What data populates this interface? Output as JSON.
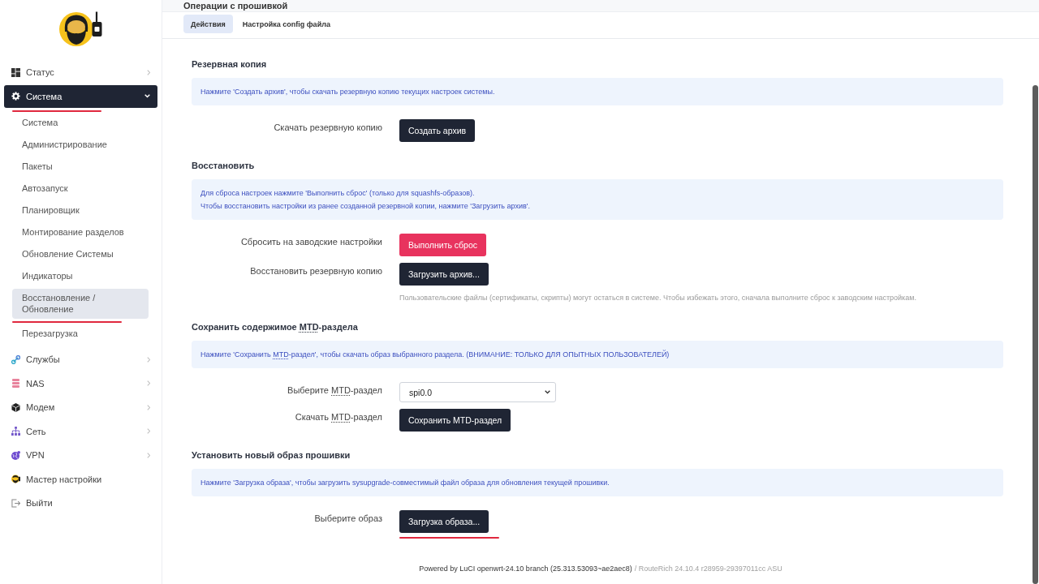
{
  "page_title": "Операции с прошивкой",
  "sidebar": {
    "items": [
      {
        "label": "Статус",
        "kind": "group",
        "expanded": false,
        "selected": false,
        "marked": false
      },
      {
        "label": "Система",
        "kind": "group",
        "expanded": true,
        "selected": true,
        "marked": true,
        "children": [
          {
            "label": "Система",
            "selected": false,
            "marked": false
          },
          {
            "label": "Администрирование",
            "selected": false,
            "marked": false
          },
          {
            "label": "Пакеты",
            "selected": false,
            "marked": false
          },
          {
            "label": "Автозапуск",
            "selected": false,
            "marked": false
          },
          {
            "label": "Планировщик",
            "selected": false,
            "marked": false
          },
          {
            "label": "Монтирование разделов",
            "selected": false,
            "marked": false
          },
          {
            "label": "Обновление Системы",
            "selected": false,
            "marked": false
          },
          {
            "label": "Индикаторы",
            "selected": false,
            "marked": false
          },
          {
            "label": "Восстановление / Обновление",
            "selected": true,
            "marked": true
          },
          {
            "label": "Перезагрузка",
            "selected": false,
            "marked": false
          }
        ]
      },
      {
        "label": "Службы",
        "kind": "group",
        "expanded": false,
        "selected": false,
        "marked": false
      },
      {
        "label": "NAS",
        "kind": "group",
        "expanded": false,
        "selected": false,
        "marked": false
      },
      {
        "label": "Модем",
        "kind": "group",
        "expanded": false,
        "selected": false,
        "marked": false
      },
      {
        "label": "Сеть",
        "kind": "group",
        "expanded": false,
        "selected": false,
        "marked": false
      },
      {
        "label": "VPN",
        "kind": "group",
        "expanded": false,
        "selected": false,
        "marked": false
      },
      {
        "label": "Мастер настройки",
        "kind": "link",
        "selected": false,
        "marked": false
      },
      {
        "label": "Выйти",
        "kind": "link",
        "selected": false,
        "marked": false
      }
    ]
  },
  "tabs": [
    {
      "label": "Действия",
      "selected": true
    },
    {
      "label": "Настройка config файла",
      "selected": false
    }
  ],
  "sections": [
    {
      "title": "Резервная копия",
      "info": [
        "Нажмите 'Создать архив', чтобы скачать резервную копию текущих настроек системы."
      ],
      "rows": [
        {
          "label": "Скачать резервную копию",
          "kind": "button",
          "button": "Создать архив",
          "destructive": false,
          "marked": false
        }
      ]
    },
    {
      "title": "Восстановить",
      "info": [
        "Для сброса настроек нажмите 'Выполнить сброс' (только для squashfs-образов).",
        "Чтобы восстановить настройки из ранее созданной резервной копии, нажмите 'Загрузить архив'."
      ],
      "rows": [
        {
          "label": "Сбросить на заводские настройки",
          "kind": "button",
          "button": "Выполнить сброс",
          "destructive": true,
          "marked": false
        },
        {
          "label": "Восстановить резервную копию",
          "kind": "button",
          "button": "Загрузить архив...",
          "destructive": false,
          "marked": false,
          "hint": "Пользовательские файлы (сертификаты, скрипты) могут остаться в системе. Чтобы избежать этого, сначала выполните сброс к заводским настройкам."
        }
      ]
    },
    {
      "title": [
        {
          "text": "Сохранить содержимое ",
          "abbr": false
        },
        {
          "text": "MTD",
          "abbr": true
        },
        {
          "text": "-раздела",
          "abbr": false
        }
      ],
      "info": [
        [
          {
            "text": "Нажмите 'Сохранить ",
            "abbr": false
          },
          {
            "text": "MTD",
            "abbr": true
          },
          {
            "text": "-раздел', чтобы скачать образ выбранного раздела. (ВНИМАНИЕ: ТОЛЬКО ДЛЯ ОПЫТНЫХ ПОЛЬЗОВАТЕЛЕЙ)",
            "abbr": false
          }
        ]
      ],
      "rows": [
        {
          "label": [
            {
              "text": "Выберите ",
              "abbr": false
            },
            {
              "text": "MTD",
              "abbr": true
            },
            {
              "text": "-раздел",
              "abbr": false
            }
          ],
          "kind": "select",
          "value": "spi0.0"
        },
        {
          "label": [
            {
              "text": "Скачать ",
              "abbr": false
            },
            {
              "text": "MTD",
              "abbr": true
            },
            {
              "text": "-раздел",
              "abbr": false
            }
          ],
          "kind": "button",
          "button": "Сохранить MTD-раздел",
          "destructive": false,
          "marked": false
        }
      ]
    },
    {
      "title": "Установить новый образ прошивки",
      "info": [
        "Нажмите 'Загрузка образа', чтобы загрузить sysupgrade-совместимый файл образа для обновления текущей прошивки."
      ],
      "rows": [
        {
          "label": "Выберите образ",
          "kind": "button",
          "button": "Загрузка образа...",
          "destructive": false,
          "marked": true
        }
      ]
    }
  ],
  "footer": {
    "text": "Powered by LuCI openwrt-24.10 branch (25.313.53093~ae2aec8)",
    "version": "/ RouteRich 24.10.4 r28959-29397011cc ASU"
  }
}
